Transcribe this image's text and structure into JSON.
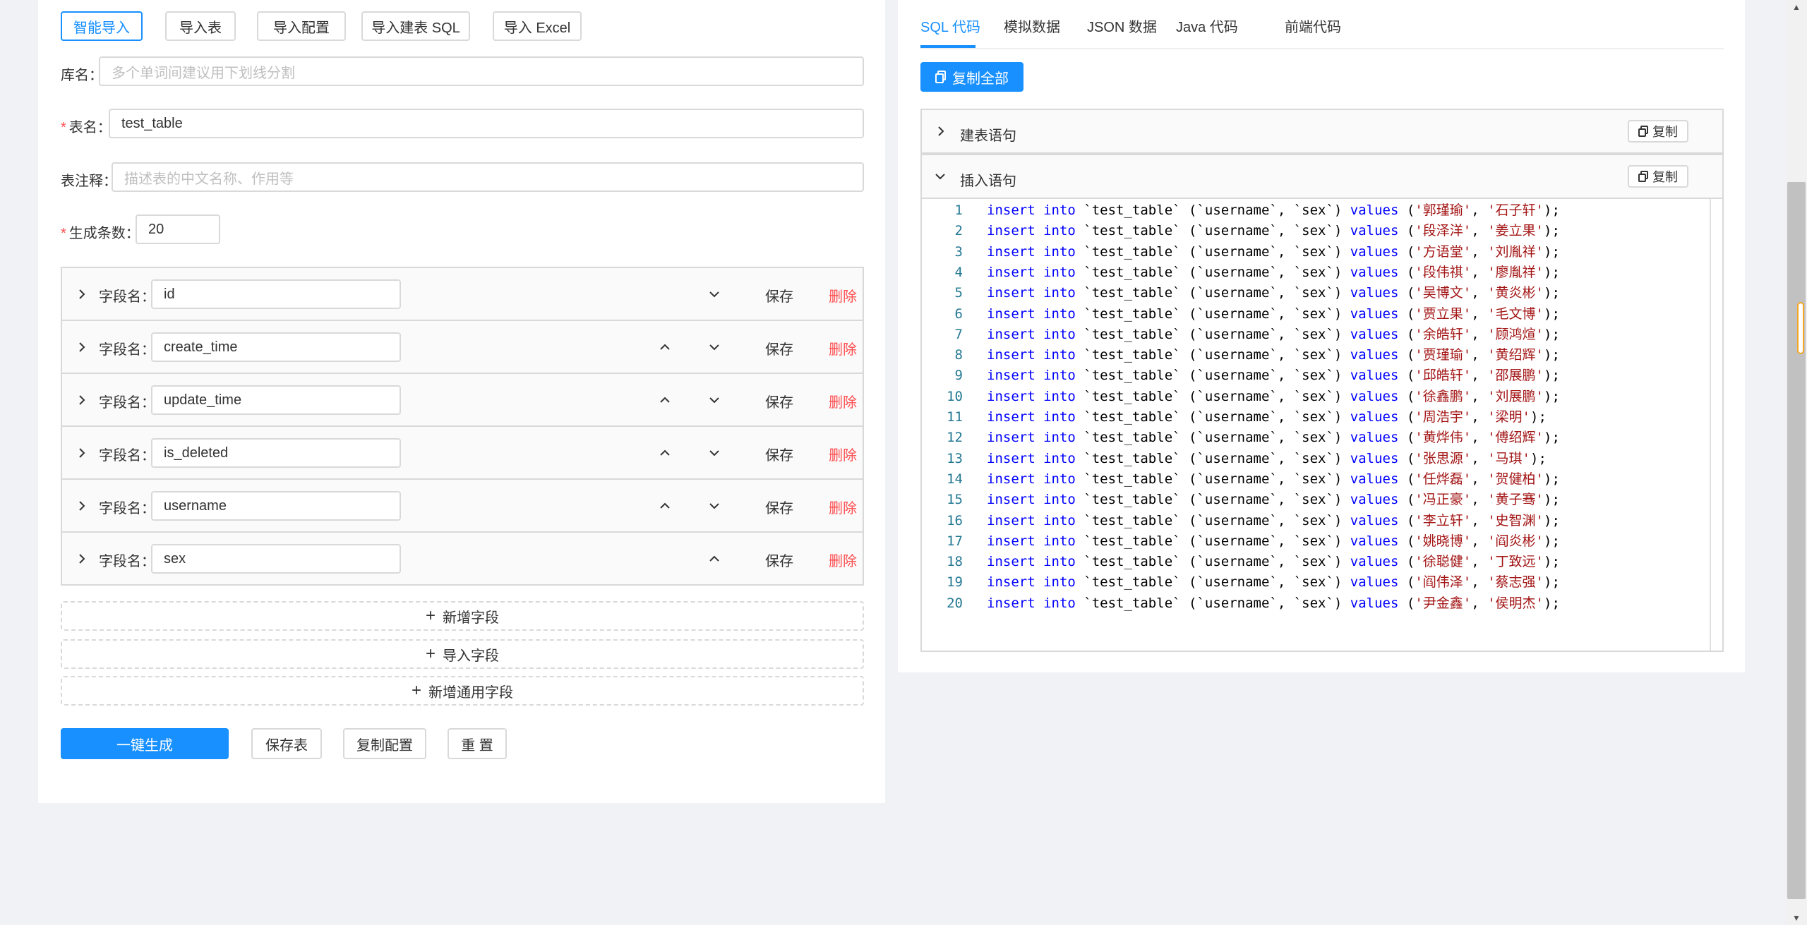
{
  "import_buttons": [
    "智能导入",
    "导入表",
    "导入配置",
    "导入建表 SQL",
    "导入 Excel"
  ],
  "form": {
    "db_label": "库名：",
    "db_placeholder": "多个单词间建议用下划线分割",
    "table_label": "表名：",
    "table_value": "test_table",
    "comment_label": "表注释：",
    "comment_placeholder": "描述表的中文名称、作用等",
    "count_label": "生成条数：",
    "count_value": "20",
    "required_mark": "*"
  },
  "field_label": "字段名：",
  "save_label": "保存",
  "delete_label": "删除",
  "fields": [
    "id",
    "create_time",
    "update_time",
    "is_deleted",
    "username",
    "sex"
  ],
  "add_field": "新增字段",
  "import_field": "导入字段",
  "add_common_field": "新增通用字段",
  "actions": {
    "generate": "一键生成",
    "save_table": "保存表",
    "copy_config": "复制配置",
    "reset": "重 置"
  },
  "tabs": [
    "SQL 代码",
    "模拟数据",
    "JSON 数据",
    "Java 代码",
    "前端代码"
  ],
  "copy_all": "复制全部",
  "sections": {
    "create": "建表语句",
    "insert": "插入语句",
    "copy": "复制"
  },
  "code": {
    "kw1": "insert",
    "kw2": "into",
    "kw3": "values",
    "table": "`test_table`",
    "cols": "(`username`, `sex`)",
    "rows": [
      [
        "郭瑾瑜",
        "石子轩"
      ],
      [
        "段泽洋",
        "姜立果"
      ],
      [
        "方语堂",
        "刘胤祥"
      ],
      [
        "段伟祺",
        "廖胤祥"
      ],
      [
        "吴博文",
        "黄炎彬"
      ],
      [
        "贾立果",
        "毛文博"
      ],
      [
        "余皓轩",
        "顾鸿煊"
      ],
      [
        "贾瑾瑜",
        "黄绍辉"
      ],
      [
        "邱皓轩",
        "邵展鹏"
      ],
      [
        "徐鑫鹏",
        "刘展鹏"
      ],
      [
        "周浩宇",
        "梁明"
      ],
      [
        "黄烨伟",
        "傅绍辉"
      ],
      [
        "张思源",
        "马琪"
      ],
      [
        "任烨磊",
        "贺健柏"
      ],
      [
        "冯正豪",
        "黄子骞"
      ],
      [
        "李立轩",
        "史智渊"
      ],
      [
        "姚晓博",
        "阎炎彬"
      ],
      [
        "徐聪健",
        "丁致远"
      ],
      [
        "阎伟泽",
        "蔡志强"
      ],
      [
        "尹金鑫",
        "侯明杰"
      ]
    ]
  },
  "colors": {
    "primary": "#1890ff",
    "danger": "#ff4d4f",
    "keyword": "#0000ff",
    "string": "#a31515",
    "line_number": "#237893"
  }
}
